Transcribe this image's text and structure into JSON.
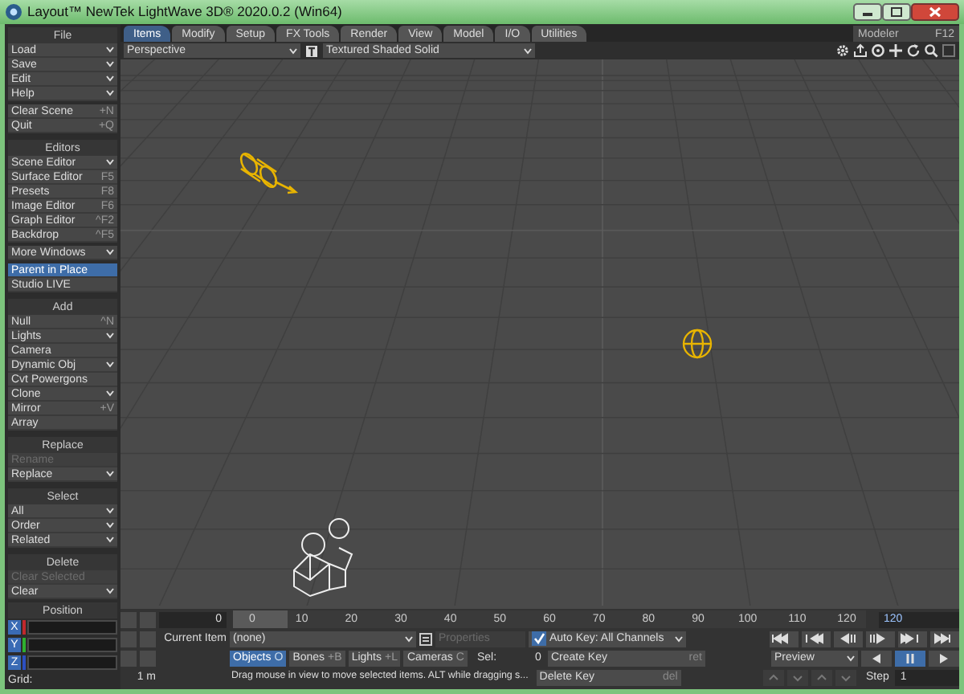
{
  "window": {
    "title": "Layout™ NewTek LightWave 3D® 2020.0.2 (Win64)"
  },
  "tabs": [
    {
      "label": "Items",
      "selected": true
    },
    {
      "label": "Modify",
      "selected": false
    },
    {
      "label": "Setup",
      "selected": false
    },
    {
      "label": "FX Tools",
      "selected": false
    },
    {
      "label": "Render",
      "selected": false
    },
    {
      "label": "View",
      "selected": false
    },
    {
      "label": "Model",
      "selected": false
    },
    {
      "label": "I/O",
      "selected": false
    },
    {
      "label": "Utilities",
      "selected": false
    }
  ],
  "modeler_button": {
    "label": "Modeler",
    "shortcut": "F12"
  },
  "viewport": {
    "view": "Perspective",
    "shading": "Textured Shaded Solid"
  },
  "sidebar": {
    "sections": [
      {
        "title": "File",
        "groups": [
          [
            {
              "label": "Load",
              "kind": "menu",
              "disabled": false,
              "selected": false
            },
            {
              "label": "Save",
              "kind": "menu",
              "disabled": false,
              "selected": false
            },
            {
              "label": "Edit",
              "kind": "menu",
              "disabled": false,
              "selected": false
            },
            {
              "label": "Help",
              "kind": "menu",
              "disabled": false,
              "selected": false
            }
          ],
          [
            {
              "label": "Clear Scene",
              "kind": "shortcut",
              "shortcut": "+N",
              "disabled": false,
              "selected": false
            },
            {
              "label": "Quit",
              "kind": "shortcut",
              "shortcut": "+Q",
              "disabled": false,
              "selected": false
            }
          ]
        ]
      },
      {
        "title": "Editors",
        "groups": [
          [
            {
              "label": "Scene Editor",
              "kind": "menu",
              "disabled": false,
              "selected": false
            },
            {
              "label": "Surface Editor",
              "kind": "shortcut",
              "shortcut": "F5",
              "disabled": false,
              "selected": false
            },
            {
              "label": "Presets",
              "kind": "shortcut",
              "shortcut": "F8",
              "disabled": false,
              "selected": false
            },
            {
              "label": "Image Editor",
              "kind": "shortcut",
              "shortcut": "F6",
              "disabled": false,
              "selected": false
            },
            {
              "label": "Graph Editor",
              "kind": "shortcut",
              "shortcut": "^F2",
              "disabled": false,
              "selected": false
            },
            {
              "label": "Backdrop",
              "kind": "shortcut",
              "shortcut": "^F5",
              "disabled": false,
              "selected": false
            }
          ],
          [
            {
              "label": "More Windows",
              "kind": "menu",
              "disabled": false,
              "selected": false
            }
          ],
          [
            {
              "label": "Parent in Place",
              "kind": "plain",
              "disabled": false,
              "selected": true
            },
            {
              "label": "Studio LIVE",
              "kind": "plain",
              "disabled": false,
              "selected": false
            }
          ]
        ]
      },
      {
        "title": "Add",
        "groups": [
          [
            {
              "label": "Null",
              "kind": "shortcut",
              "shortcut": "^N",
              "disabled": false,
              "selected": false
            },
            {
              "label": "Lights",
              "kind": "menu",
              "disabled": false,
              "selected": false
            },
            {
              "label": "Camera",
              "kind": "plain",
              "disabled": false,
              "selected": false
            },
            {
              "label": "Dynamic Obj",
              "kind": "menu",
              "disabled": false,
              "selected": false
            },
            {
              "label": "Cvt Powergons",
              "kind": "plain",
              "disabled": false,
              "selected": false
            },
            {
              "label": "Clone",
              "kind": "menu",
              "disabled": false,
              "selected": false
            },
            {
              "label": "Mirror",
              "kind": "shortcut",
              "shortcut": "+V",
              "disabled": false,
              "selected": false
            },
            {
              "label": "Array",
              "kind": "plain",
              "disabled": false,
              "selected": false
            }
          ]
        ]
      },
      {
        "title": "Replace",
        "groups": [
          [
            {
              "label": "Rename",
              "kind": "plain",
              "disabled": true,
              "selected": false
            },
            {
              "label": "Replace",
              "kind": "menu",
              "disabled": false,
              "selected": false
            }
          ]
        ]
      },
      {
        "title": "Select",
        "groups": [
          [
            {
              "label": "All",
              "kind": "menu",
              "disabled": false,
              "selected": false
            },
            {
              "label": "Order",
              "kind": "menu",
              "disabled": false,
              "selected": false
            },
            {
              "label": "Related",
              "kind": "menu",
              "disabled": false,
              "selected": false
            }
          ]
        ]
      },
      {
        "title": "Delete",
        "groups": [
          [
            {
              "label": "Clear Selected",
              "kind": "plain",
              "disabled": true,
              "selected": false
            },
            {
              "label": "Clear",
              "kind": "menu",
              "disabled": false,
              "selected": false
            }
          ]
        ]
      }
    ],
    "position": {
      "title": "Position",
      "axes": [
        {
          "label": "X",
          "color": "#c0282c"
        },
        {
          "label": "Y",
          "color": "#2fb02f"
        },
        {
          "label": "Z",
          "color": "#2c4fc0"
        }
      ]
    },
    "grid": {
      "label": "Grid:",
      "value": "1 m"
    }
  },
  "timeline": {
    "frame": "0",
    "ticks": [
      "0",
      "10",
      "20",
      "30",
      "40",
      "50",
      "60",
      "70",
      "80",
      "90",
      "100",
      "110",
      "120"
    ],
    "end": "120",
    "level": 0
  },
  "current_item": {
    "label": "Current Item",
    "value": "(none)"
  },
  "properties_button": {
    "label": "Properties",
    "disabled": true
  },
  "item_types": [
    {
      "label": "Objects",
      "shortcut": "O",
      "selected": true
    },
    {
      "label": "Bones",
      "shortcut": "+B",
      "selected": false
    },
    {
      "label": "Lights",
      "shortcut": "+L",
      "selected": false
    },
    {
      "label": "Cameras",
      "shortcut": "C",
      "selected": false
    }
  ],
  "selection": {
    "label": "Sel:",
    "value": "0"
  },
  "status": "Drag mouse in view to move selected items. ALT while dragging s...",
  "auto_key": {
    "checked": true,
    "label": "Auto Key: All Channels"
  },
  "create_key": {
    "label": "Create Key",
    "shortcut": "ret"
  },
  "delete_key": {
    "label": "Delete Key",
    "shortcut": "del"
  },
  "preview": "Preview",
  "playback": [
    {
      "kind": "reverse",
      "selected": false
    },
    {
      "kind": "pause",
      "selected": true
    },
    {
      "kind": "play",
      "selected": false
    }
  ],
  "step": {
    "label": "Step",
    "value": "1"
  }
}
